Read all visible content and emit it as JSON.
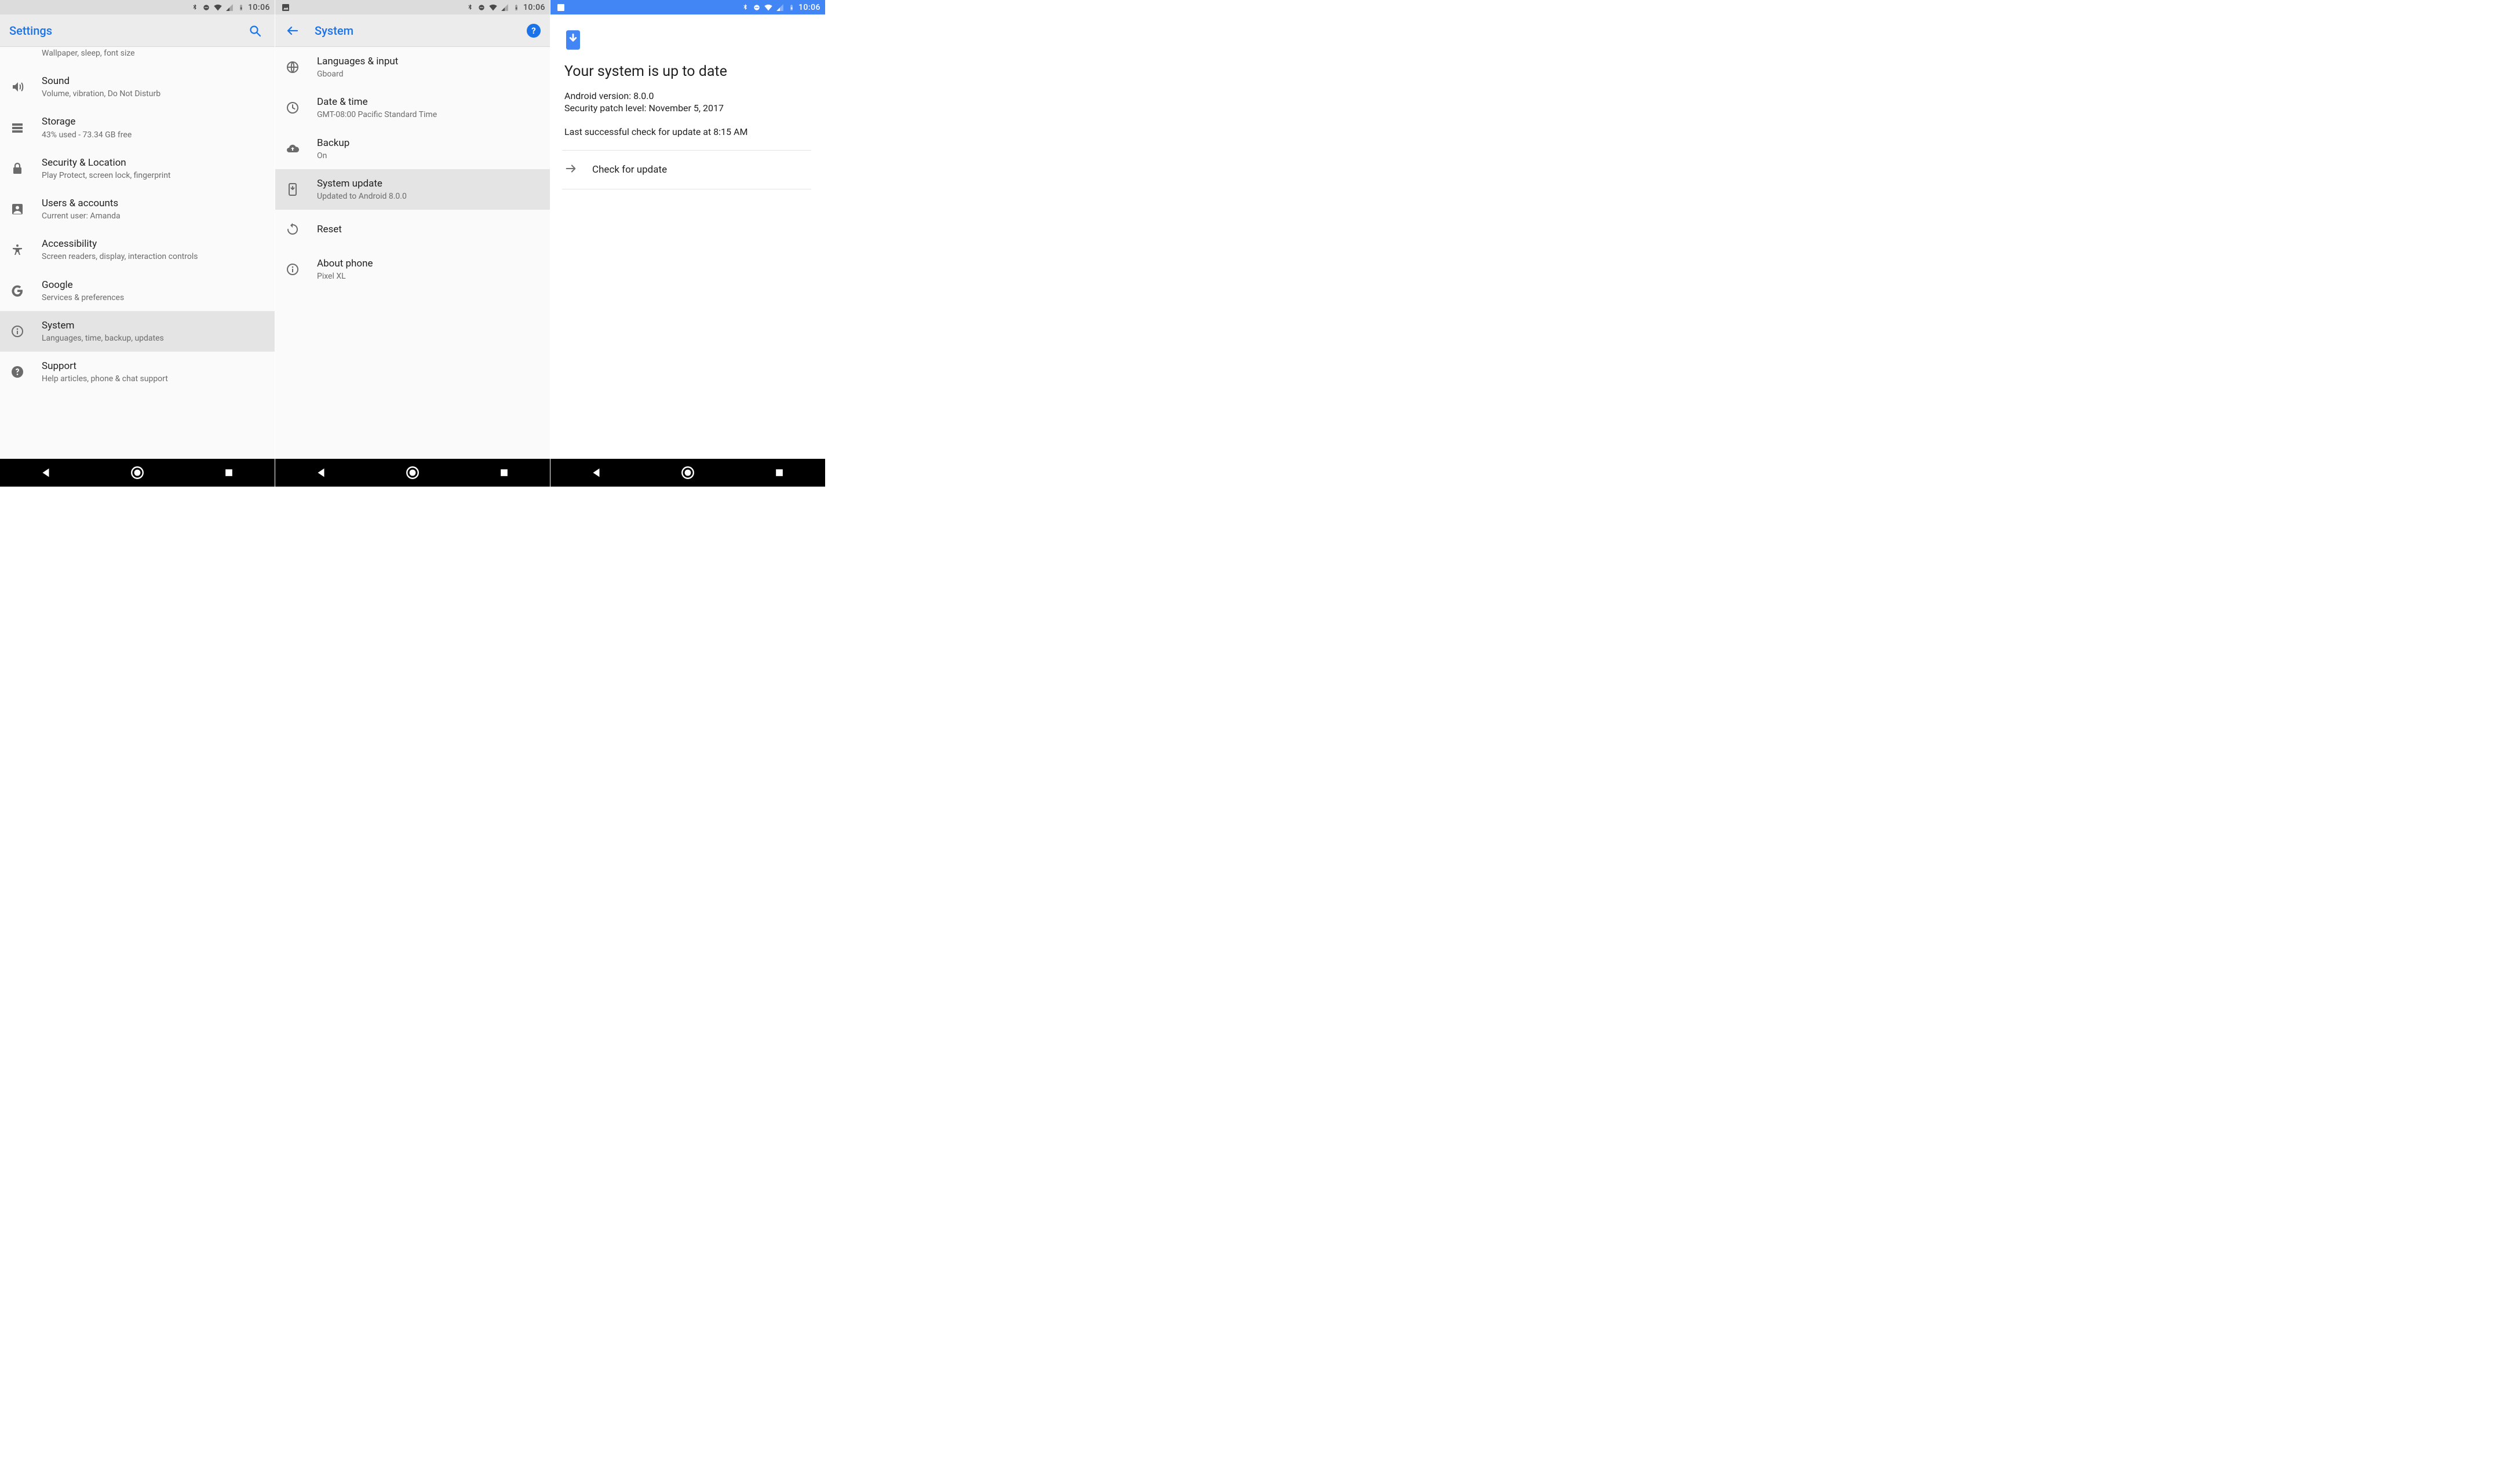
{
  "clock": "10:06",
  "screen1": {
    "title": "Settings",
    "partial_subtitle": "Wallpaper, sleep, font size",
    "items": [
      {
        "icon": "volume",
        "title": "Sound",
        "subtitle": "Volume, vibration, Do Not Disturb"
      },
      {
        "icon": "storage",
        "title": "Storage",
        "subtitle": "43% used - 73.34 GB free"
      },
      {
        "icon": "lock",
        "title": "Security & Location",
        "subtitle": "Play Protect, screen lock, fingerprint"
      },
      {
        "icon": "account",
        "title": "Users & accounts",
        "subtitle": "Current user: Amanda"
      },
      {
        "icon": "access",
        "title": "Accessibility",
        "subtitle": "Screen readers, display, interaction controls"
      },
      {
        "icon": "google",
        "title": "Google",
        "subtitle": "Services & preferences"
      },
      {
        "icon": "info",
        "title": "System",
        "subtitle": "Languages, time, backup, updates",
        "selected": true
      },
      {
        "icon": "help",
        "title": "Support",
        "subtitle": "Help articles, phone & chat support"
      }
    ]
  },
  "screen2": {
    "title": "System",
    "items": [
      {
        "icon": "globe",
        "title": "Languages & input",
        "subtitle": "Gboard"
      },
      {
        "icon": "clock",
        "title": "Date & time",
        "subtitle": "GMT-08:00 Pacific Standard Time"
      },
      {
        "icon": "cloudup",
        "title": "Backup",
        "subtitle": "On"
      },
      {
        "icon": "sysupd",
        "title": "System update",
        "subtitle": "Updated to Android 8.0.0",
        "selected": true
      },
      {
        "icon": "reset",
        "title": "Reset"
      },
      {
        "icon": "info",
        "title": "About phone",
        "subtitle": "Pixel XL"
      }
    ]
  },
  "screen3": {
    "headline": "Your system is up to date",
    "line1": "Android version: 8.0.0",
    "line2": "Security patch level: November 5, 2017",
    "line3": "Last successful check for update at 8:15 AM",
    "cta": "Check for update"
  }
}
